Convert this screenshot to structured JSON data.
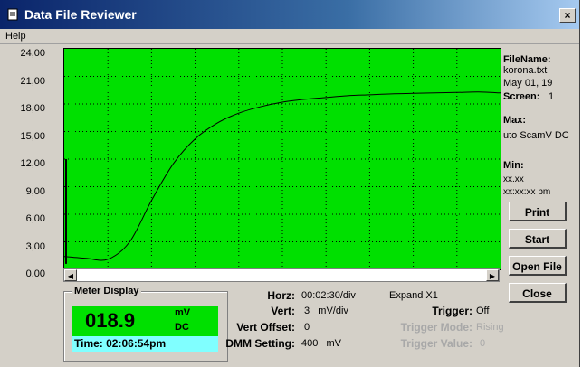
{
  "window": {
    "title": "Data File Reviewer",
    "close_label": "×"
  },
  "menu": {
    "help": "Help"
  },
  "chart_data": {
    "type": "line",
    "y_ticks": [
      "24,00",
      "21,00",
      "18,00",
      "15,00",
      "12,00",
      "9,00",
      "6,00",
      "3,00",
      "0,00"
    ],
    "ylim": [
      0,
      24
    ],
    "xlim": [
      0,
      10
    ],
    "grid": true,
    "background": "#00e000",
    "line_color": "#000000",
    "series": [
      {
        "x": [
          0,
          0.5,
          1.0,
          1.5,
          2.0,
          2.5,
          3.0,
          3.5,
          4.0,
          4.5,
          5.0,
          5.5,
          6.0,
          6.5,
          7.0,
          7.5,
          8.0,
          8.5,
          9.0,
          9.5,
          10.0
        ],
        "y": [
          1.4,
          1.2,
          1.1,
          3.0,
          7.5,
          11.5,
          14.2,
          15.9,
          17.0,
          17.7,
          18.2,
          18.5,
          18.7,
          18.9,
          19.0,
          19.1,
          19.15,
          19.2,
          19.25,
          19.3,
          19.2
        ]
      }
    ]
  },
  "info": {
    "filename_label": "FileName:",
    "filename": "korona.txt",
    "date": "May 01, 19",
    "screen_label": "Screen:",
    "screen_value": "1",
    "max_label": "Max:",
    "max_value": "uto ScamV DC",
    "min_label": "Min:",
    "min_value1": "xx.xx",
    "min_value2": "xx:xx:xx pm"
  },
  "buttons": {
    "print": "Print",
    "start": "Start",
    "open_file": "Open File",
    "close": "Close"
  },
  "meter": {
    "title": "Meter Display",
    "value": "018.9",
    "unit": "mV",
    "mode": "DC",
    "time": "Time: 02:06:54pm"
  },
  "settings": {
    "horz_label": "Horz:",
    "horz_value": "00:02:30/div",
    "vert_label": "Vert:",
    "vert_value": "3   mV/div",
    "offset_label": "Vert Offset:",
    "offset_value": "0",
    "dmm_label": "DMM Setting:",
    "dmm_value": "400   mV",
    "expand": "Expand X1",
    "trigger_label": "Trigger:",
    "trigger_value": "Off",
    "trigger_mode_label": "Trigger Mode:",
    "trigger_mode_value": "Rising",
    "trigger_value_label": "Trigger Value:",
    "trigger_value_value": "0"
  }
}
